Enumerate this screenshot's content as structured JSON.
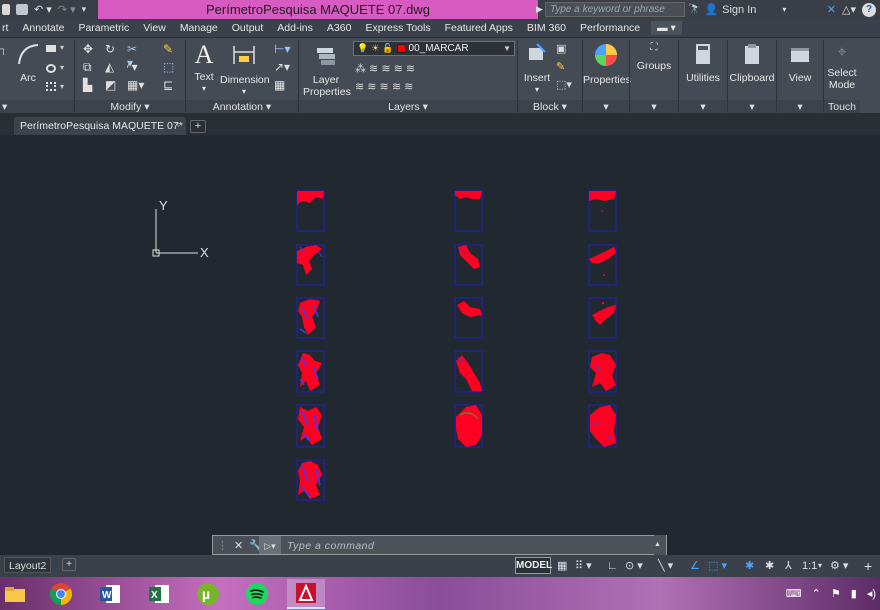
{
  "window": {
    "title": "PerímetroPesquisa MAQUETE 07.dwg",
    "search_placeholder": "Type a keyword or phrase",
    "sign_in": "Sign In"
  },
  "ribbon_tabs": [
    "rt",
    "Annotate",
    "Parametric",
    "View",
    "Manage",
    "Output",
    "Add-ins",
    "A360",
    "Express Tools",
    "Featured Apps",
    "BIM 360",
    "Performance"
  ],
  "ribbon": {
    "draw_arc": "Arc",
    "modify_label": "Modify",
    "text_label": "Text",
    "dimension_label": "Dimension",
    "annotation_label": "Annotation",
    "layer_properties_line1": "Layer",
    "layer_properties_line2": "Properties",
    "current_layer": "00_MARCAR",
    "layer_color": "#ff0000",
    "layers_label": "Layers",
    "insert_label": "Insert",
    "block_label": "Block",
    "properties_label": "Properties",
    "groups_label": "Groups",
    "utilities_label": "Utilities",
    "clipboard_label": "Clipboard",
    "view_label": "View",
    "select_mode_line1": "Select",
    "select_mode_line2": "Mode",
    "touch_label": "Touch"
  },
  "file_tab": {
    "name": "PerímetroPesquisa MAQUETE 07*",
    "close": "×",
    "add": "+"
  },
  "ucs": {
    "x_label": "X",
    "y_label": "Y"
  },
  "command_line": {
    "placeholder": "Type a command"
  },
  "layout_tabs": {
    "current": "Layout2",
    "add": "+"
  },
  "status_bar": {
    "model": "MODEL",
    "scale": "1:1"
  },
  "taskbar": {
    "apps": [
      "file-explorer-icon",
      "chrome-icon",
      "word-icon",
      "excel-icon",
      "utorrent-icon",
      "spotify-icon",
      "autocad-icon"
    ]
  }
}
